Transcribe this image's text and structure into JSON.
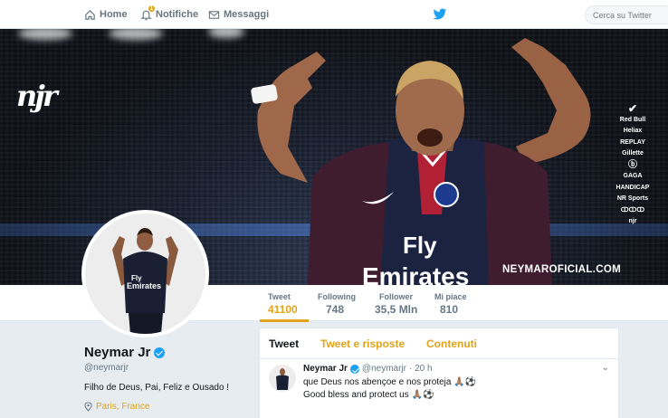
{
  "nav": {
    "home_label": "Home",
    "notifications_label": "Notifiche",
    "notifications_badge": "1",
    "messages_label": "Messaggi",
    "search_placeholder": "Cerca su Twitter"
  },
  "banner": {
    "logo_text": "njr",
    "sponsors": [
      "Red Bull",
      "Heliax",
      "REPLAY",
      "Gillette",
      "GAGA",
      "HANDICAP",
      "NR Sports",
      "ↀↀↀ",
      "njr"
    ],
    "website": "NEYMAROFICIAL.COM",
    "jersey_text_line1": "Fly",
    "jersey_text_line2": "Emirates"
  },
  "stats": [
    {
      "label": "Tweet",
      "value": "41100",
      "active": true
    },
    {
      "label": "Following",
      "value": "748",
      "active": false
    },
    {
      "label": "Follower",
      "value": "35,5 Mln",
      "active": false
    },
    {
      "label": "Mi piace",
      "value": "810",
      "active": false
    }
  ],
  "profile": {
    "name": "Neymar Jr",
    "handle": "@neymarjr",
    "bio": "Filho de Deus, Pai, Feliz e Ousado !",
    "location": "Paris, France"
  },
  "timeline": {
    "tabs": [
      "Tweet",
      "Tweet e risposte",
      "Contenuti"
    ],
    "tweet": {
      "name": "Neymar Jr",
      "handle": "@neymarjr",
      "time": "· 20 h",
      "line1": "que Deus nos abençoe e nos proteja 🙏🏽⚽",
      "line2": "Good bless and protect us 🙏🏽⚽"
    }
  },
  "colors": {
    "accent": "#e0a31b",
    "twitter_blue": "#1da1f2",
    "psg_navy": "#1c2340"
  }
}
